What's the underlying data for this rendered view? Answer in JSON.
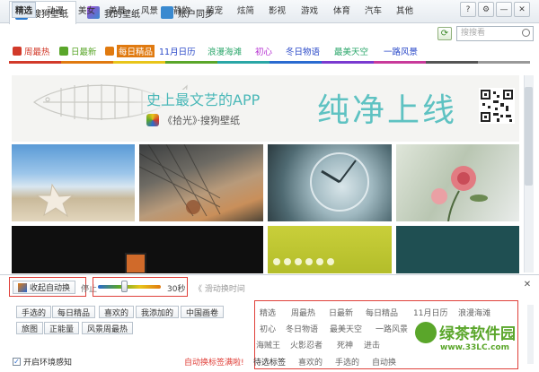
{
  "tabs": [
    {
      "label": "搜狗壁纸",
      "active": true
    },
    {
      "label": "我的壁纸",
      "active": false
    },
    {
      "label": "账户同步",
      "active": false
    }
  ],
  "window_buttons": [
    "?",
    "⚙",
    "—",
    "✕"
  ],
  "categories": [
    "精选",
    "动漫",
    "美女",
    "美景",
    "风景",
    "静物",
    "萌宠",
    "炫简",
    "影视",
    "游戏",
    "体育",
    "汽车",
    "其他"
  ],
  "search": {
    "placeholder": "搜搜看"
  },
  "tags": [
    {
      "label": "周最热",
      "color": "#d23a2a"
    },
    {
      "label": "日最新",
      "color": "#5aa62a"
    },
    {
      "label": "每日精品",
      "color": "#e07a10"
    },
    {
      "label": "11月日历",
      "color": "#2a49c8"
    },
    {
      "label": "浪漫海滩",
      "color": "#2aa66a"
    },
    {
      "label": "初心",
      "color": "#b32ad0"
    },
    {
      "label": "冬日物语",
      "color": "#2a49c8"
    },
    {
      "label": "最美天空",
      "color": "#2aa66a"
    },
    {
      "label": "一路风景",
      "color": "#2a49c8"
    }
  ],
  "color_strip": [
    "#d23a2a",
    "#e07a10",
    "#e8c51a",
    "#5aa62a",
    "#2aa6a6",
    "#2a6ad0",
    "#7a3ad0",
    "#c83a9a",
    "#555555",
    "#999999"
  ],
  "banner": {
    "headline": "史上最文艺的APP",
    "app_name": "《拾光》·搜狗壁纸",
    "slogan": "纯净上线"
  },
  "bottom": {
    "collapse_auto_label": "收起自动换",
    "stop_label": "停止",
    "slider_value_label": "30秒",
    "slider_level_fraction": 0.42,
    "switch_time_label": "《 滑动换时间",
    "source_buttons_row1": [
      "手选的",
      "每日精品",
      "喜欢的",
      "我添加的",
      "中国画卷"
    ],
    "source_buttons_row2": [
      "旅图",
      "正能量",
      "风景周最热"
    ],
    "env_checkbox_label": "开启环境感知",
    "auto_switch_note": "自动换标签满啦!",
    "right_tags_row1": [
      "精选",
      "周最热",
      "日最新",
      "每日精品",
      "11月日历",
      "浪漫海滩"
    ],
    "right_tags_row2": [
      "初心",
      "冬日物语",
      "最美天空",
      "一路风景"
    ],
    "right_tags_row3": [
      "海贼王",
      "火影忍者",
      "死神",
      "进击"
    ],
    "right_tags_row4": [
      "待选标签",
      "喜欢的",
      "手选的",
      "自动换"
    ],
    "watermark": "绿茶软件园",
    "watermark_url": "www.33LC.com"
  }
}
